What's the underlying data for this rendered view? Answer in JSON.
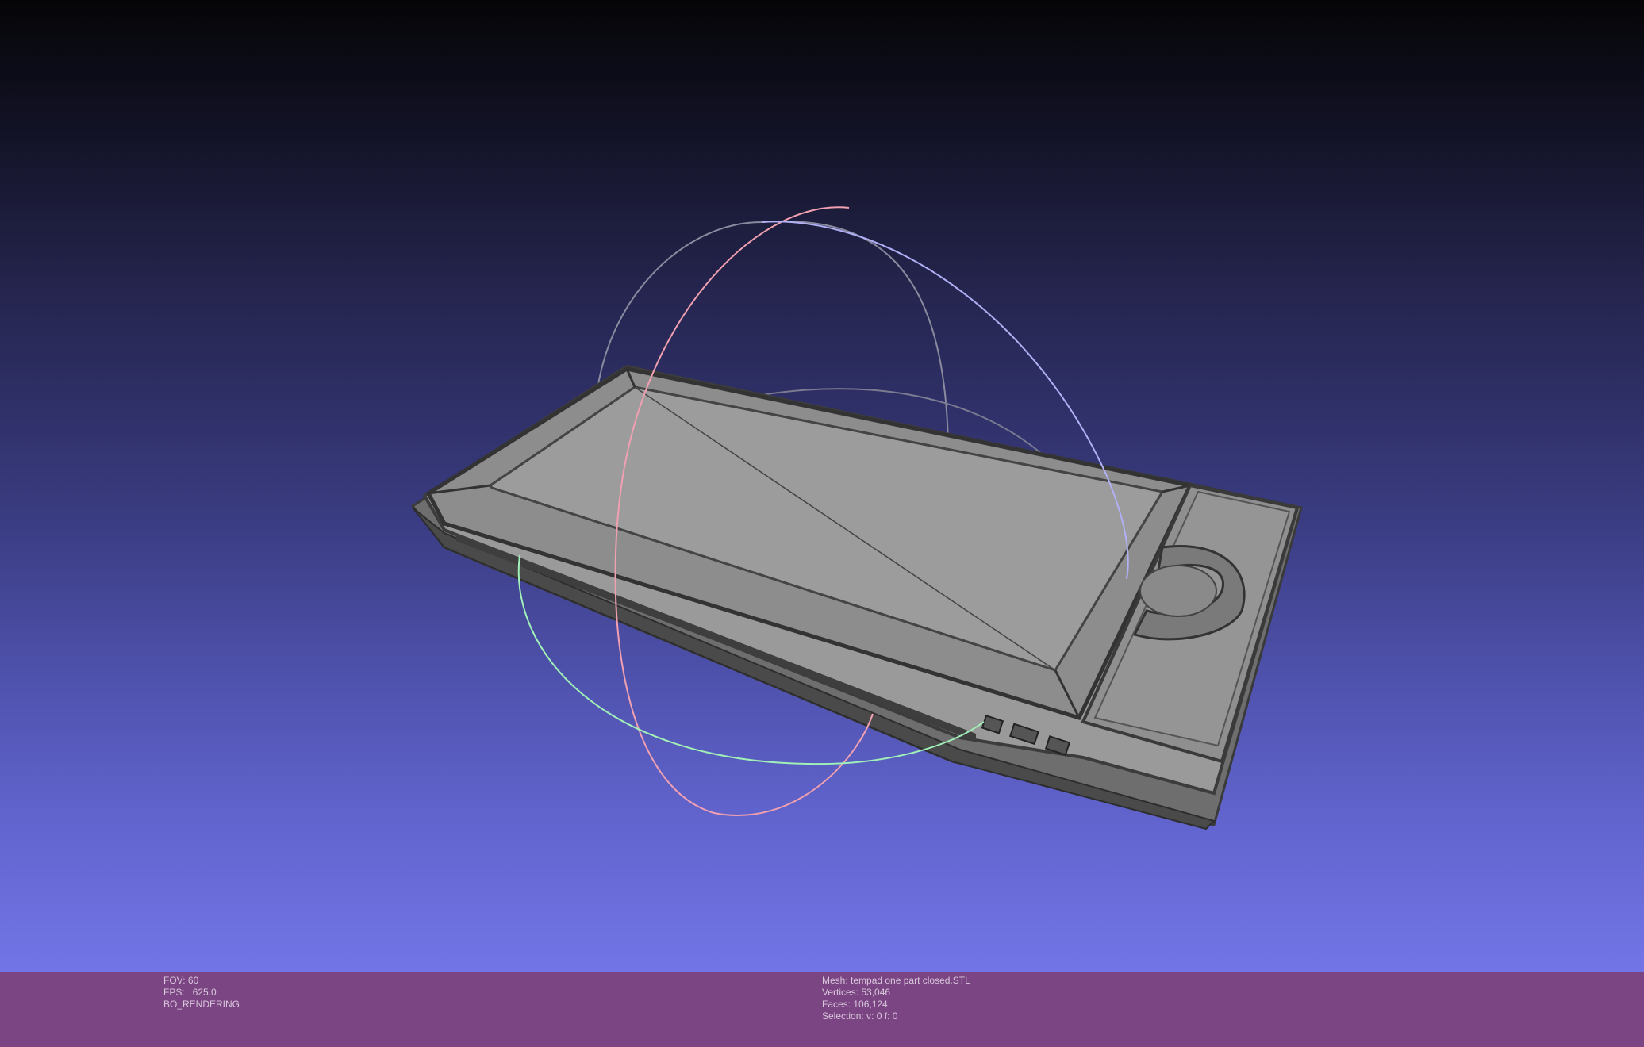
{
  "viewer": {
    "background_top": "#050507",
    "background_bottom": "#7275e6",
    "statusbar_color": "#7b4483",
    "trackball_colors": {
      "x": "#f0a0b0",
      "y": "#a0f0b8",
      "z": "#a8a8f0"
    }
  },
  "render_info": {
    "fov": "FOV: 60",
    "fps": "FPS:   625.0",
    "mode": "BO_RENDERING"
  },
  "mesh_info": {
    "mesh": "Mesh: tempad one part closed.STL",
    "vertices": "Vertices: 53,046",
    "faces": "Faces: 106,124",
    "selection": "Selection: v: 0 f: 0"
  }
}
